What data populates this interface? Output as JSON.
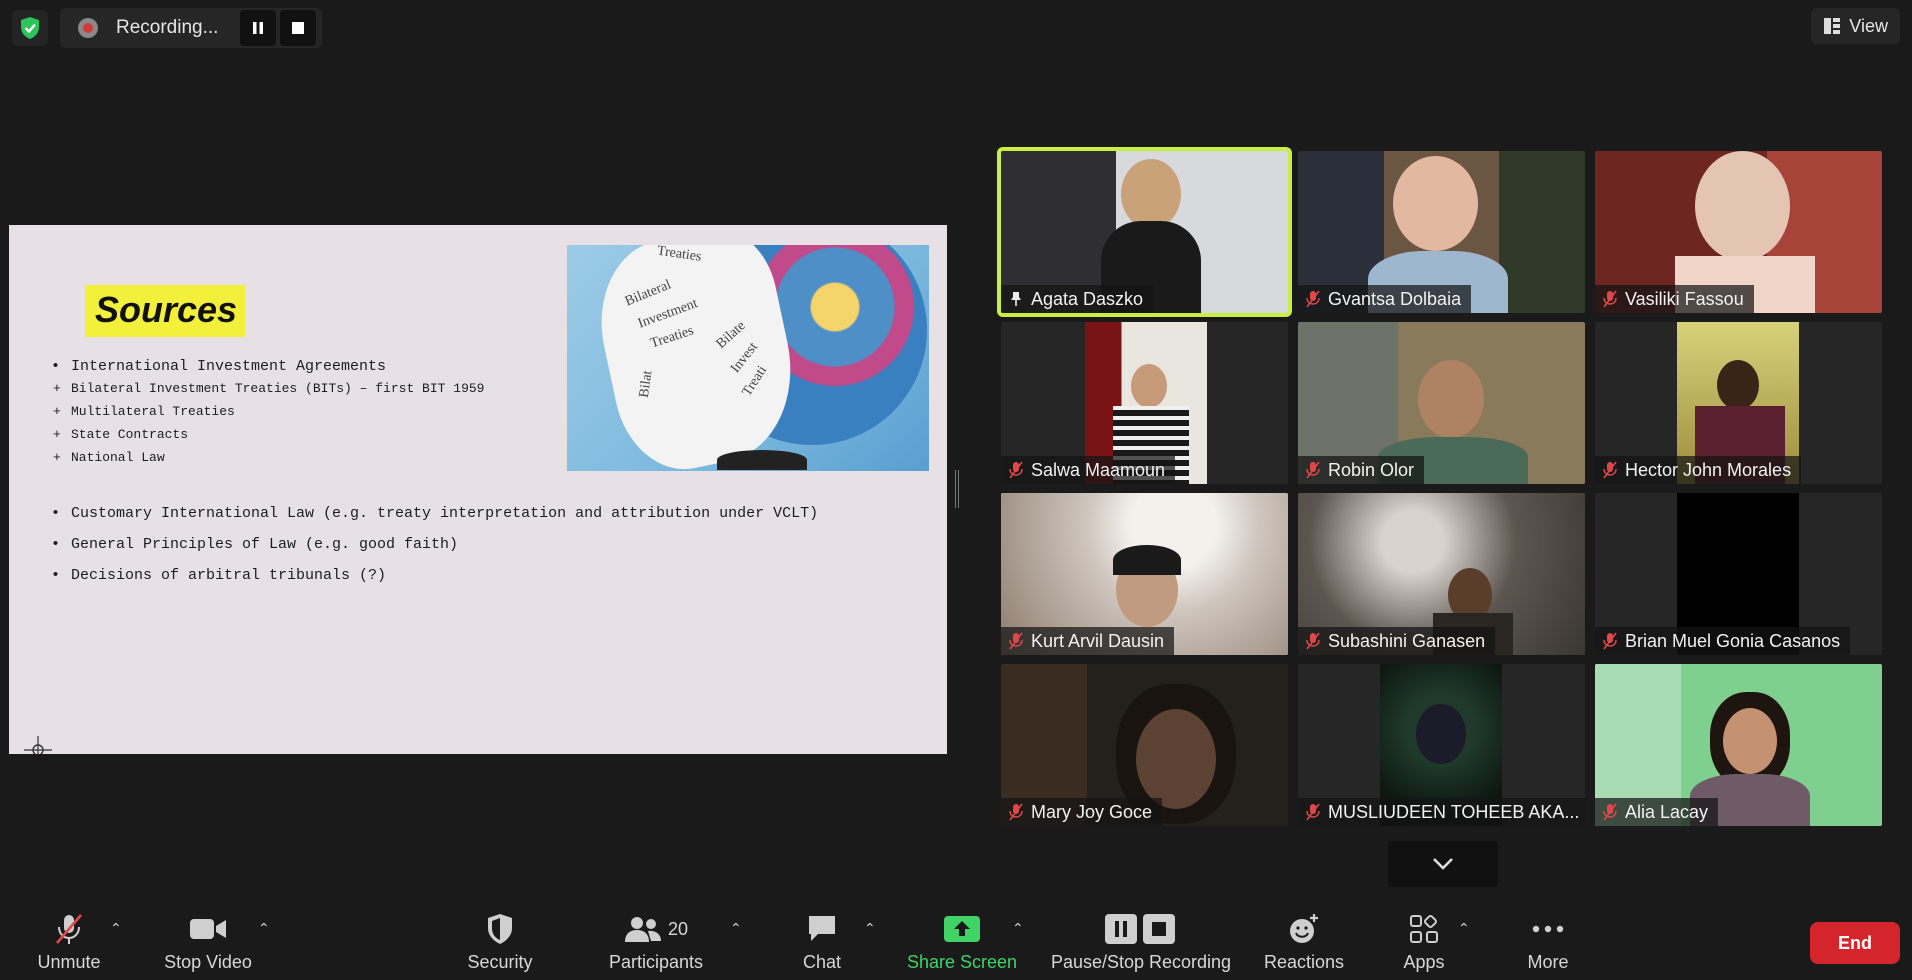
{
  "recording": {
    "status": "Recording..."
  },
  "view": {
    "label": "View"
  },
  "slide": {
    "title": "Sources",
    "bullets": [
      "International Investment Agreements"
    ],
    "sub_bullets": [
      "Bilateral Investment Treaties (BITs) – first BIT 1959",
      "Multilateral Treaties",
      "State Contracts",
      "National Law"
    ],
    "more_bullets": [
      "Customary International Law (e.g. treaty interpretation and attribution under VCLT)",
      "General Principles of Law (e.g. good faith)",
      "Decisions of arbitral tribunals (?)"
    ],
    "image_words": [
      "Bilateral",
      "Investment",
      "Treaties",
      "Bilate",
      "Invest",
      "Treati",
      "Bilat",
      "Treaties"
    ]
  },
  "participants_tiles": [
    {
      "name": "Agata Daszko",
      "pinned": true,
      "muted": false
    },
    {
      "name": "Gvantsa Dolbaia",
      "pinned": false,
      "muted": true
    },
    {
      "name": "Vasiliki Fassou",
      "pinned": false,
      "muted": true
    },
    {
      "name": "Salwa Maamoun",
      "pinned": false,
      "muted": true
    },
    {
      "name": "Robin Olor",
      "pinned": false,
      "muted": true
    },
    {
      "name": "Hector John Morales",
      "pinned": false,
      "muted": true
    },
    {
      "name": "Kurt Arvil Dausin",
      "pinned": false,
      "muted": true
    },
    {
      "name": "Subashini Ganasen",
      "pinned": false,
      "muted": true
    },
    {
      "name": "Brian Muel Gonia Casanos",
      "pinned": false,
      "muted": true
    },
    {
      "name": "Mary Joy Goce",
      "pinned": false,
      "muted": true
    },
    {
      "name": "MUSLIUDEEN TOHEEB AKA...",
      "pinned": false,
      "muted": true
    },
    {
      "name": "Alia Lacay",
      "pinned": false,
      "muted": true
    }
  ],
  "toolbar": {
    "unmute": "Unmute",
    "stop_video": "Stop Video",
    "security": "Security",
    "participants": "Participants",
    "participants_count": "20",
    "chat": "Chat",
    "share_screen": "Share Screen",
    "pause_stop": "Pause/Stop Recording",
    "reactions": "Reactions",
    "apps": "Apps",
    "more": "More",
    "end": "End"
  },
  "colors": {
    "active_speaker": "#c9ef45",
    "share_green": "#40d365",
    "end_red": "#d3252b",
    "muted_red": "#e04848"
  }
}
